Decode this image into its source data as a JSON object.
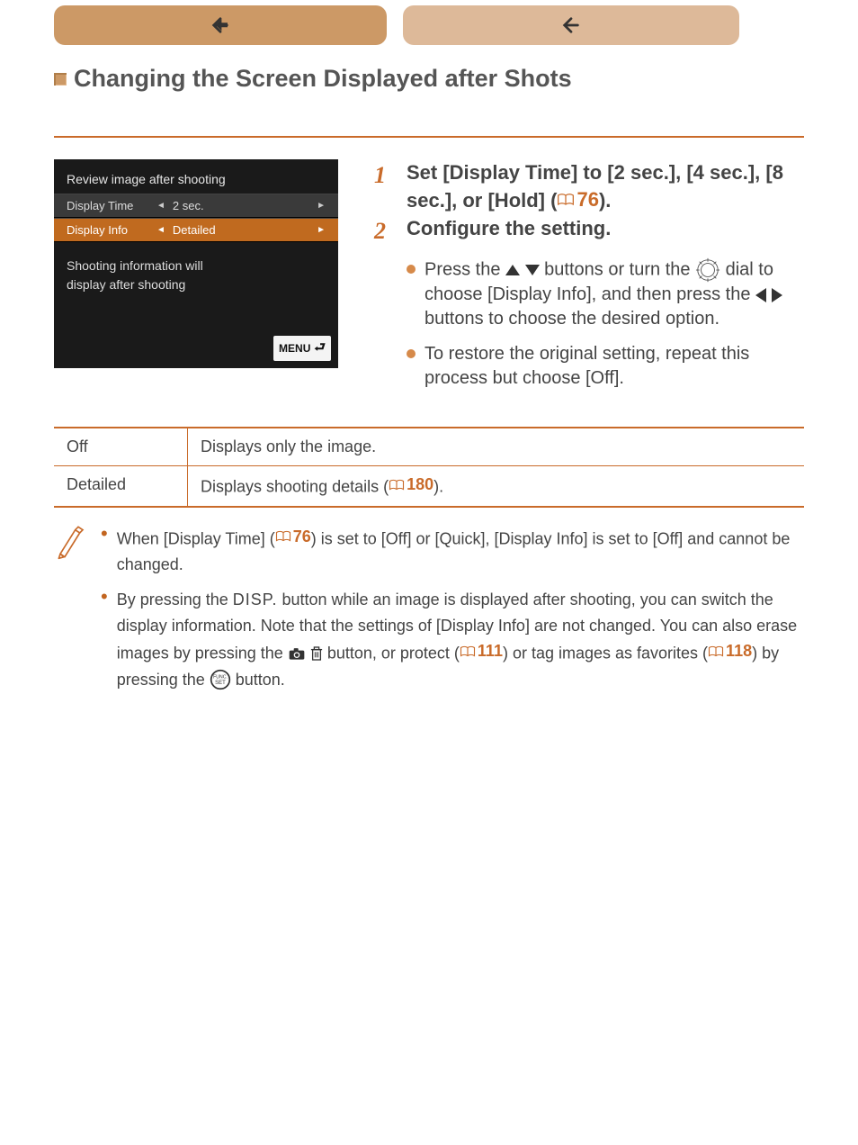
{
  "heading": "Changing the Screen Displayed after Shots",
  "camscreen": {
    "title": "Review image after shooting",
    "row1_label": "Display Time",
    "row1_value": "2 sec.",
    "row2_label": "Display Info",
    "row2_value": "Detailed",
    "desc_line1": "Shooting information will",
    "desc_line2": "display after shooting",
    "menu_label": "MENU"
  },
  "steps": {
    "s1_num": "1",
    "s1_text_a": "Set [Display Time] to [2 sec.], [4 sec.], [8 sec.], or [Hold] (",
    "s1_ref_page": "76",
    "s1_text_b": ").",
    "s2_num": "2",
    "s2_text": "Configure the setting.",
    "sub1_a": "Press the ",
    "sub1_b": " buttons or turn the ",
    "sub1_c": " dial to choose [Display Info], and then press the ",
    "sub1_d": " buttons to choose the desired option.",
    "sub2_a": "To restore the original setting, repeat this process but choose [Off]."
  },
  "table": {
    "h1": "Off",
    "h2": "Displays only the image.",
    "r1c1": "Detailed",
    "r1c2_a": "Displays shooting details (",
    "r1c2_page": "180",
    "r1c2_b": ")."
  },
  "notes": {
    "n1_a": "When [Display Time] (",
    "n1_page": "76",
    "n1_b": ") is set to [Off] or [Quick], [Display Info] is set to [Off] and cannot be changed.",
    "n2_a": "By pressing the ",
    "n2_disp": "DISP.",
    "n2_b": " button while an image is displayed after shooting, you can switch the display information. Note that the settings of [Display Info] are not changed. You can also erase images by pressing the ",
    "n2_c": " button, or protect (",
    "n2_page1": "111",
    "n2_d": ") or tag images as favorites (",
    "n2_page2": "118",
    "n2_e": ") by pressing the ",
    "n2_f": " button."
  }
}
